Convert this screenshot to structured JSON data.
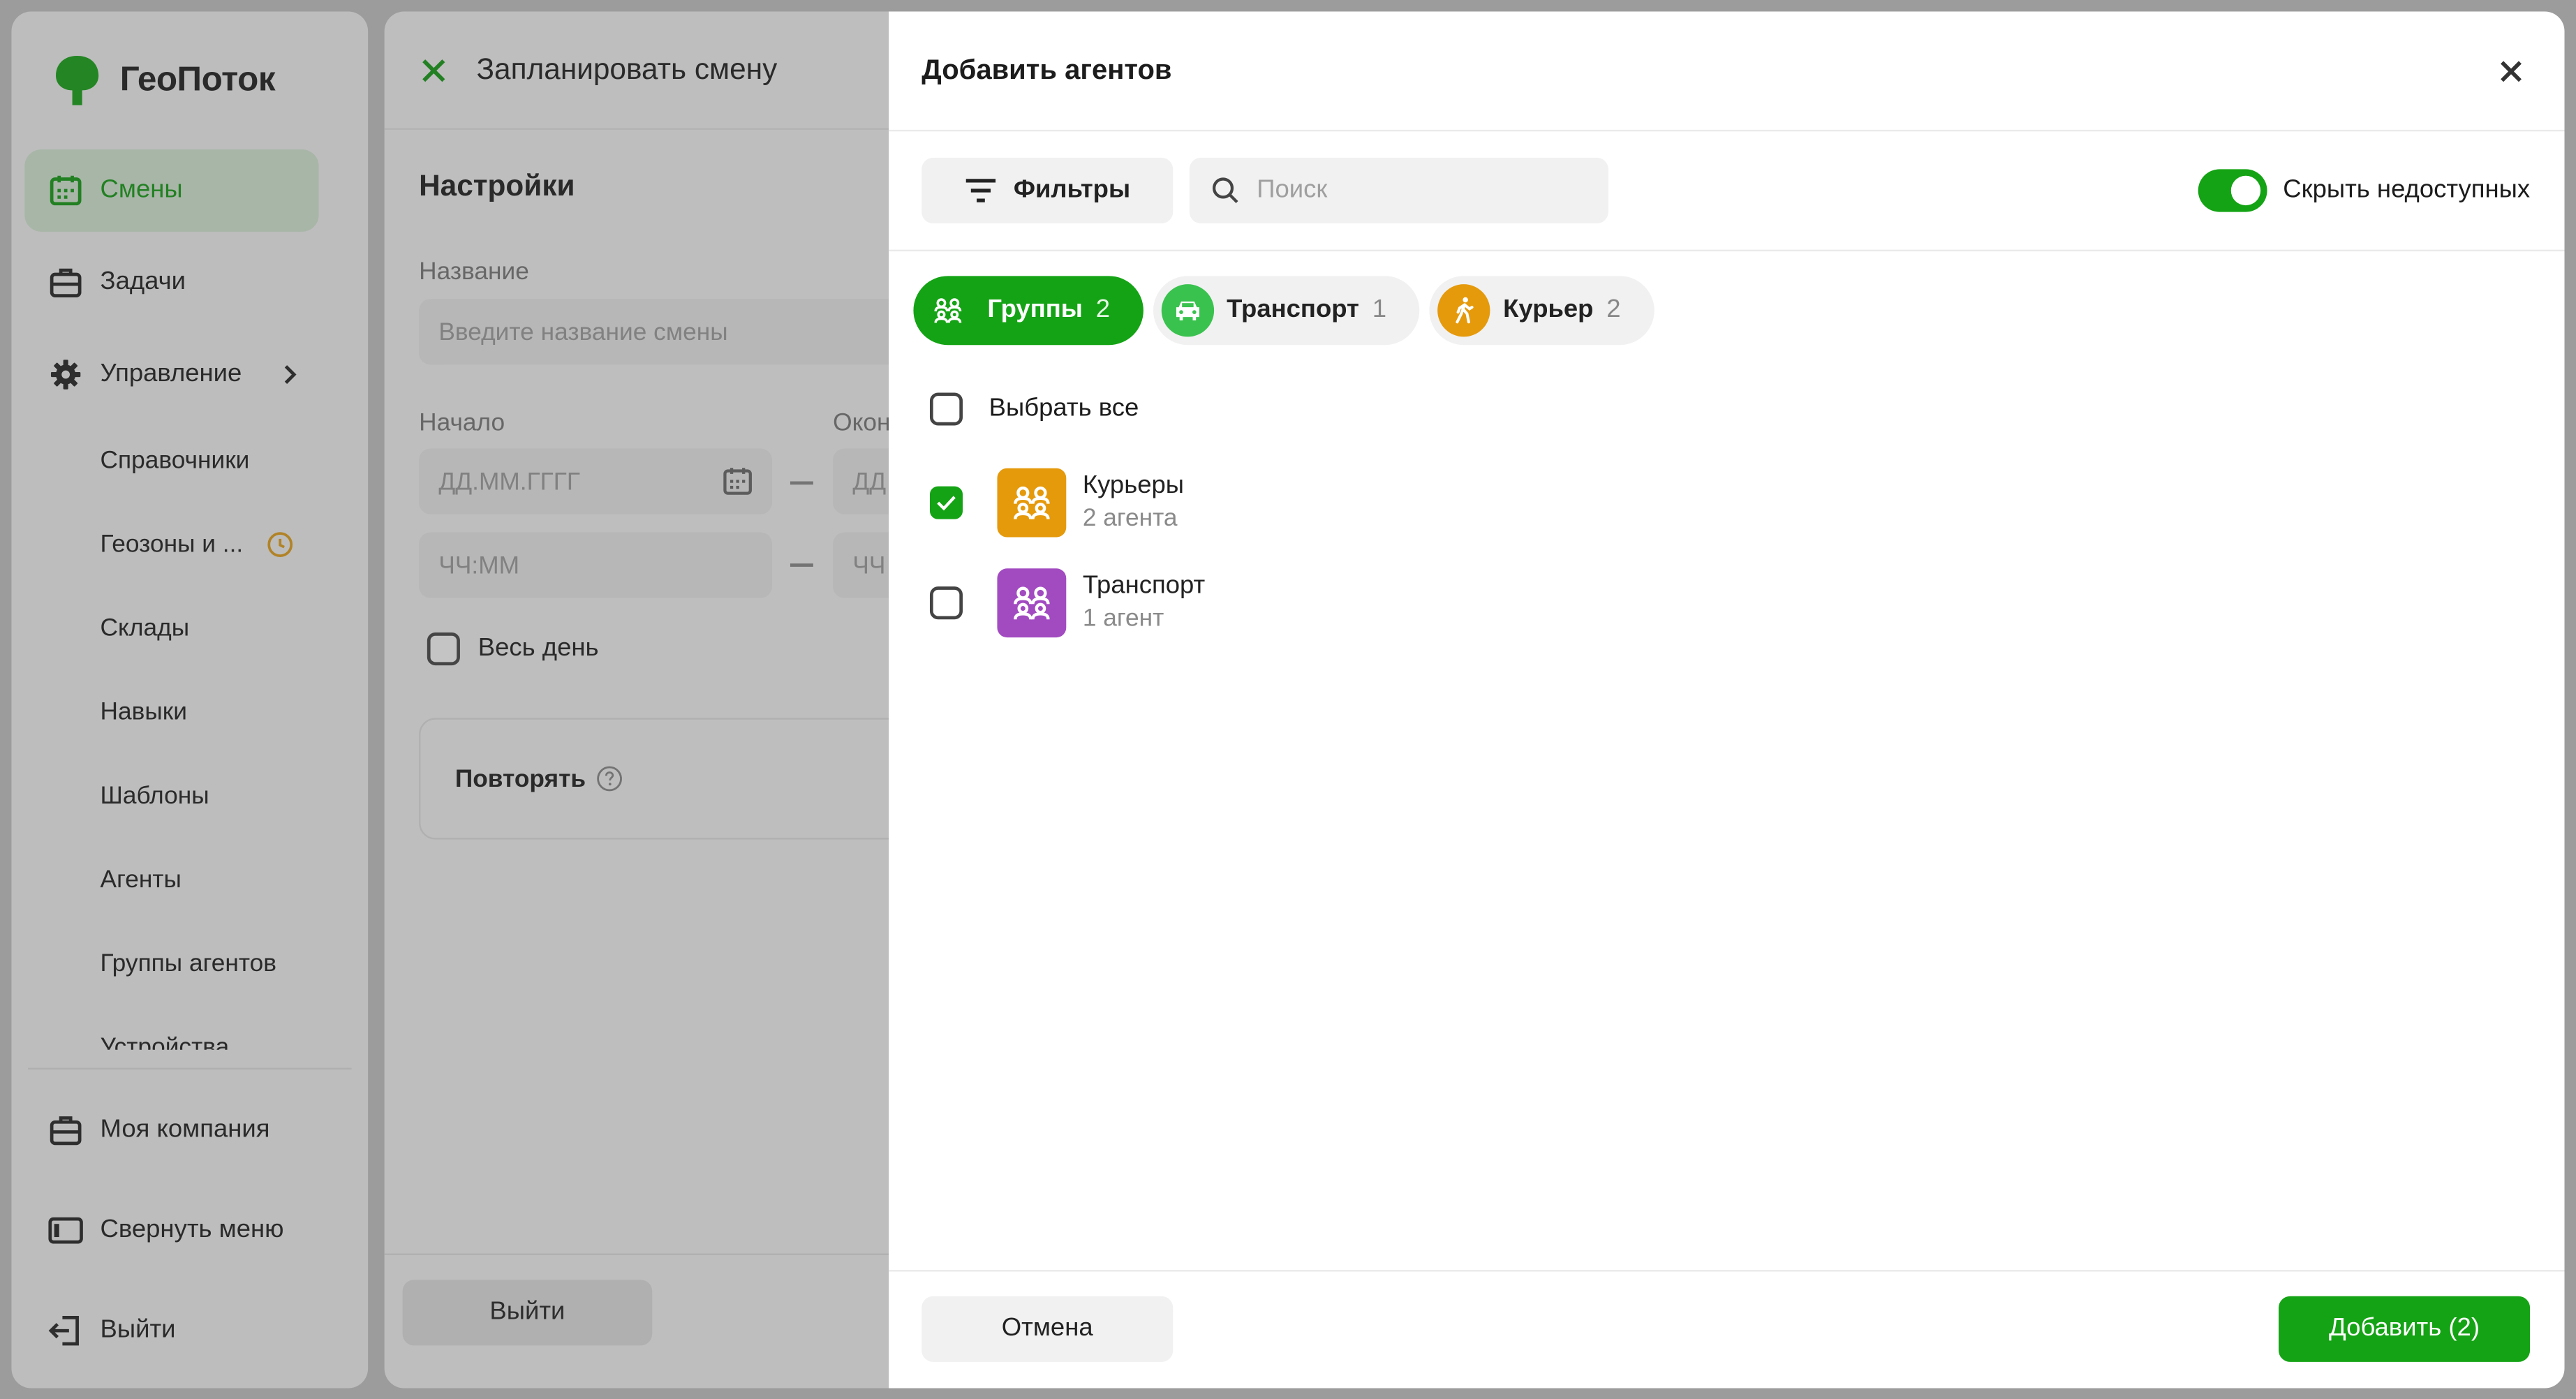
{
  "app": {
    "name": "ГеоПоток"
  },
  "sidebar": {
    "main": [
      {
        "label": "Смены",
        "icon": "calendar-icon",
        "active": true
      },
      {
        "label": "Задачи",
        "icon": "briefcase-icon"
      },
      {
        "label": "Управление",
        "icon": "gear-icon"
      }
    ],
    "sub": [
      {
        "label": "Справочники"
      },
      {
        "label": "Геозоны и ..."
      },
      {
        "label": "Склады"
      },
      {
        "label": "Навыки"
      },
      {
        "label": "Шаблоны"
      },
      {
        "label": "Агенты"
      },
      {
        "label": "Группы агентов"
      },
      {
        "label": "Устройства"
      }
    ],
    "bottom": [
      {
        "label": "Моя компания",
        "icon": "briefcase-icon"
      },
      {
        "label": "Свернуть меню",
        "icon": "sidebar-collapse-icon"
      },
      {
        "label": "Выйти",
        "icon": "logout-icon"
      }
    ]
  },
  "shift": {
    "title": "Запланировать смену",
    "section": "Настройки",
    "name_label": "Название",
    "name_placeholder": "Введите название смены",
    "start_label": "Начало",
    "end_label": "Окон",
    "date_placeholder": "ДД.ММ.ГГГГ",
    "date_placeholder_cut": "ДД",
    "time_placeholder": "ЧЧ:ММ",
    "time_placeholder_cut": "ЧЧ",
    "all_day": "Весь день",
    "repeat": "Повторять",
    "exit": "Выйти"
  },
  "modal": {
    "title": "Добавить агентов",
    "filters": "Фильтры",
    "search_placeholder": "Поиск",
    "hide_unavailable": "Скрыть недоступных",
    "hide_unavailable_on": true,
    "tabs": [
      {
        "label": "Группы",
        "count": "2",
        "active": true,
        "icon": "group-icon"
      },
      {
        "label": "Транспорт",
        "count": "1",
        "icon": "car-icon"
      },
      {
        "label": "Курьер",
        "count": "2",
        "icon": "walking-person-icon"
      }
    ],
    "select_all": "Выбрать все",
    "groups": [
      {
        "name": "Курьеры",
        "sub": "2 агента",
        "checked": true,
        "color": "#e59a0c"
      },
      {
        "name": "Транспорт",
        "sub": "1 агент",
        "checked": false,
        "color": "#a24bc1"
      }
    ],
    "cancel": "Отмена",
    "add": "Добавить (2)"
  },
  "colors": {
    "accent": "#14a314",
    "active_nav_bg": "#d6ead6",
    "courier_orange": "#e59a0c",
    "transport_purple": "#a24bc1",
    "transport_green": "#3ac24e"
  }
}
